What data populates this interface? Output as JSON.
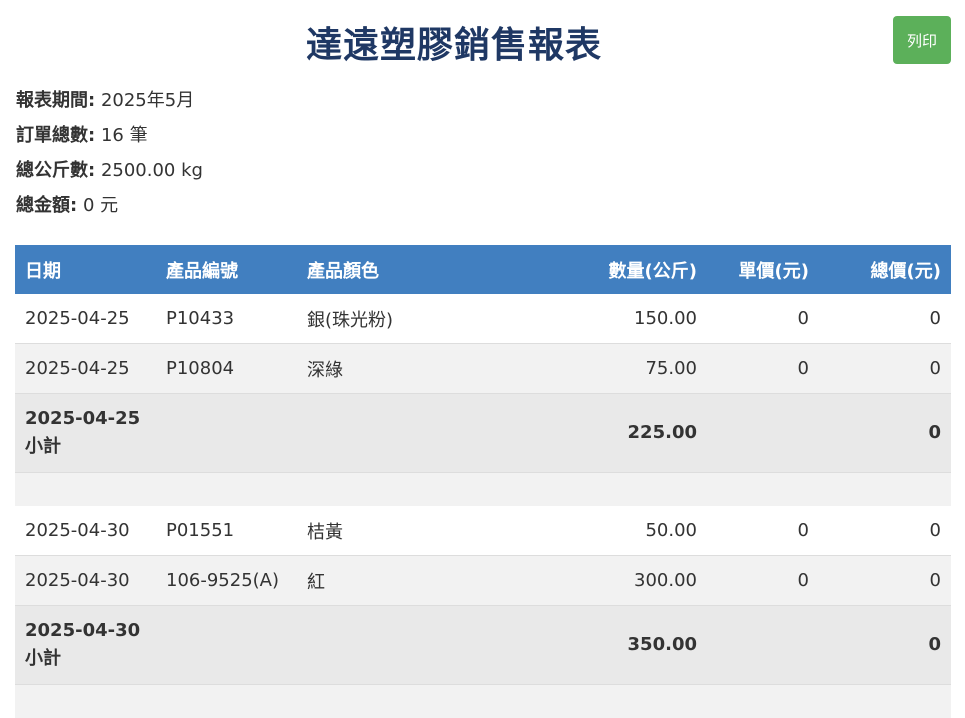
{
  "header": {
    "title": "達遠塑膠銷售報表",
    "print_label": "列印"
  },
  "summary": {
    "period_label": "報表期間:",
    "period_value": "2025年5月",
    "orders_label": "訂單總數:",
    "orders_value": "16 筆",
    "weight_label": "總公斤數:",
    "weight_value": "2500.00 kg",
    "amount_label": "總金額:",
    "amount_value": "0 元"
  },
  "table": {
    "columns": [
      "日期",
      "產品編號",
      "產品顏色",
      "數量(公斤)",
      "單價(元)",
      "總價(元)"
    ],
    "groups": [
      {
        "rows": [
          {
            "date": "2025-04-25",
            "product_no": "P10433",
            "color": "銀(珠光粉)",
            "qty": "150.00",
            "unit_price": "0",
            "total": "0"
          },
          {
            "date": "2025-04-25",
            "product_no": "P10804",
            "color": "深綠",
            "qty": "75.00",
            "unit_price": "0",
            "total": "0"
          }
        ],
        "subtotal": {
          "date": "2025-04-25",
          "label": "小計",
          "qty": "225.00",
          "total": "0"
        }
      },
      {
        "rows": [
          {
            "date": "2025-04-30",
            "product_no": "P01551",
            "color": "桔黃",
            "qty": "50.00",
            "unit_price": "0",
            "total": "0"
          },
          {
            "date": "2025-04-30",
            "product_no": "106-9525(A)",
            "color": "紅",
            "qty": "300.00",
            "unit_price": "0",
            "total": "0"
          }
        ],
        "subtotal": {
          "date": "2025-04-30",
          "label": "小計",
          "qty": "350.00",
          "total": "0"
        }
      }
    ]
  },
  "colors": {
    "title": "#1f3864",
    "header_bg": "#417fc0",
    "print_button": "#5cb05a"
  }
}
